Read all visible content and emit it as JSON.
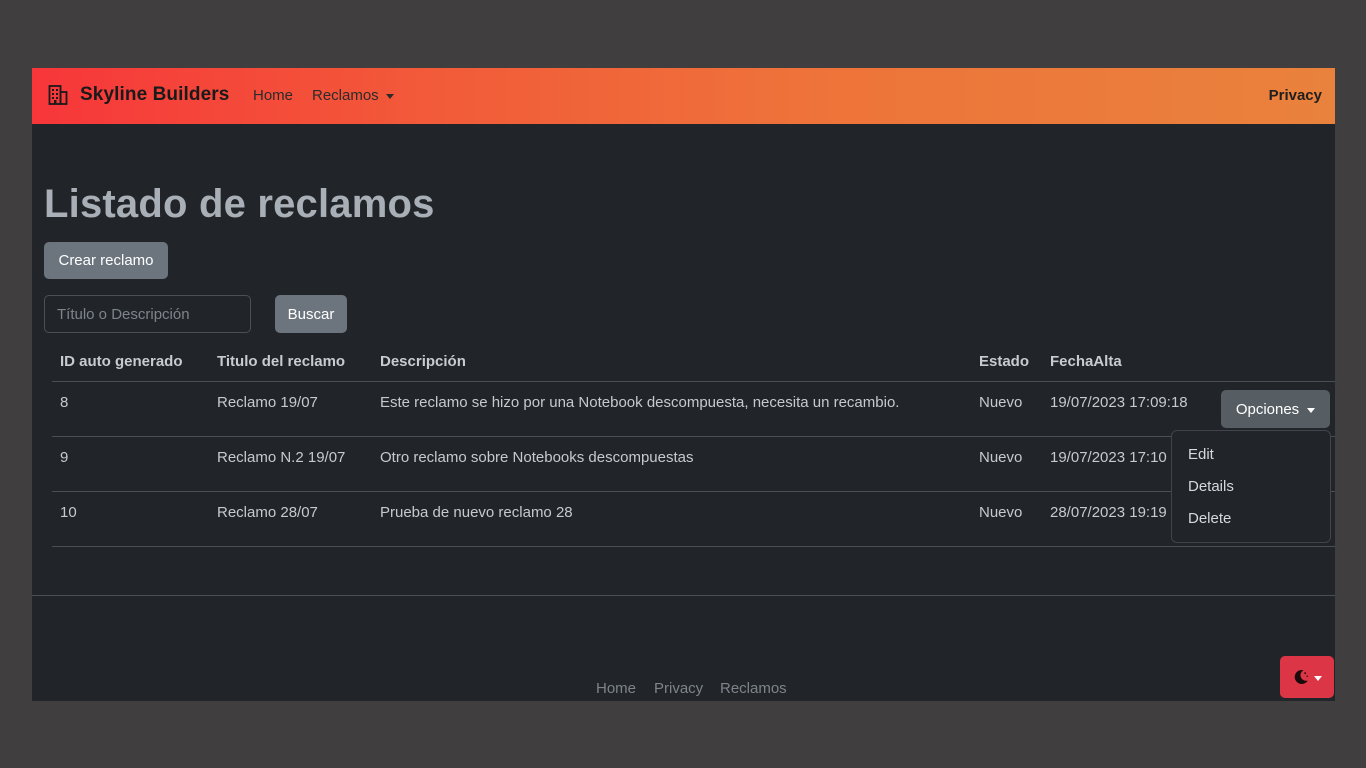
{
  "navbar": {
    "brand": "Skyline Builders",
    "brand_icon": "building-icon",
    "links": {
      "home": "Home",
      "reclamos": "Reclamos",
      "privacy": "Privacy"
    }
  },
  "main": {
    "title": "Listado de reclamos",
    "create_button": "Crear reclamo",
    "search": {
      "placeholder": "Título o Descripción",
      "value": ""
    },
    "search_button": "Buscar",
    "table": {
      "headers": [
        "ID auto generado",
        "Titulo del reclamo",
        "Descripción",
        "Estado",
        "FechaAlta"
      ],
      "rows": [
        [
          "8",
          "Reclamo 19/07",
          "Este reclamo se hizo por una Notebook descompuesta, necesita un recambio.",
          "Nuevo",
          "19/07/2023 17:09:18"
        ],
        [
          "9",
          "Reclamo N.2 19/07",
          "Otro reclamo sobre Notebooks descompuestas",
          "Nuevo",
          "19/07/2023 17:10"
        ],
        [
          "10",
          "Reclamo 28/07",
          "Prueba de nuevo reclamo 28",
          "Nuevo",
          "28/07/2023 19:19"
        ]
      ]
    },
    "options_button": "Opciones",
    "options_menu": [
      "Edit",
      "Details",
      "Delete"
    ]
  },
  "footer": {
    "links": [
      "Home",
      "Privacy",
      "Reclamos"
    ]
  },
  "theme_toggle": {
    "icon": "moon-icon"
  },
  "colors": {
    "accent_gradient_start": "#f7363a",
    "accent_gradient_end": "#e9823c",
    "background": "#212529",
    "theme_button": "#dc3545"
  }
}
